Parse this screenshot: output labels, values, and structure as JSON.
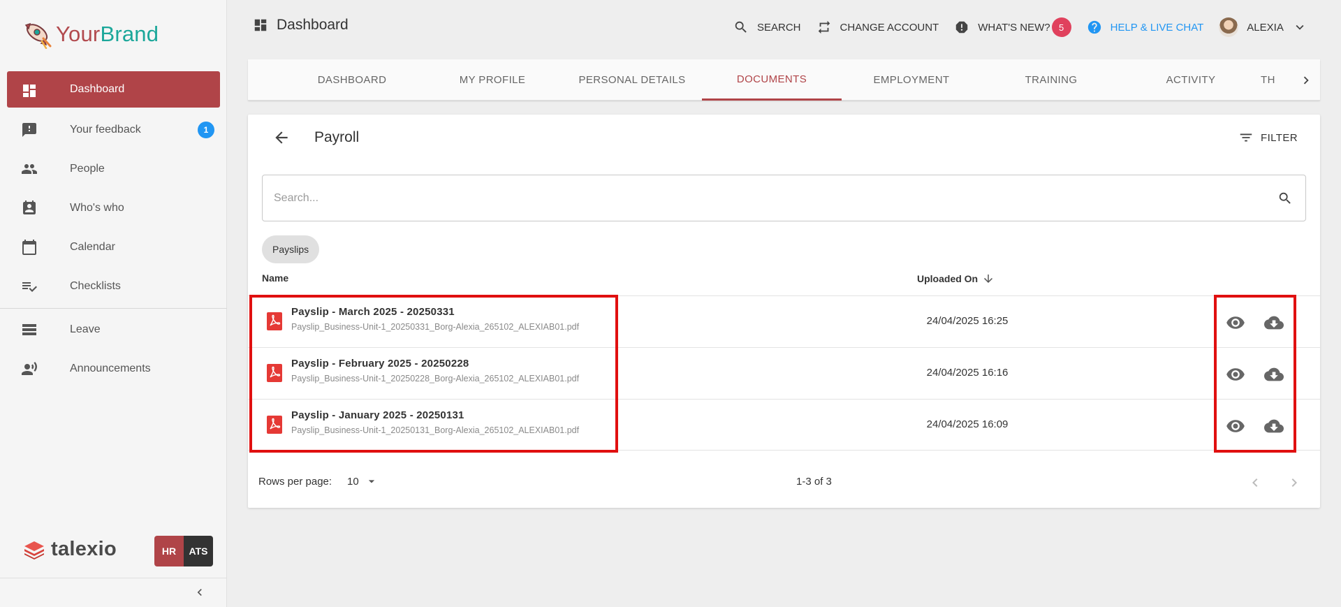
{
  "brand": {
    "part1": "Your",
    "part2": "Brand",
    "color1": "#b24a4e",
    "color2": "#1ba79a"
  },
  "sidebar": {
    "items": [
      {
        "label": "Dashboard",
        "icon": "dashboard-icon",
        "active": true
      },
      {
        "label": "Your feedback",
        "icon": "feedback-icon",
        "badge": "1"
      },
      {
        "label": "People",
        "icon": "people-icon"
      },
      {
        "label": "Who's who",
        "icon": "contact-card-icon"
      },
      {
        "label": "Calendar",
        "icon": "calendar-icon"
      },
      {
        "label": "Checklists",
        "icon": "checklist-icon"
      },
      {
        "label": "Leave",
        "icon": "leave-icon"
      },
      {
        "label": "Announcements",
        "icon": "announcement-icon"
      }
    ],
    "footer": {
      "product": "talexio",
      "hr": "HR",
      "ats": "ATS"
    }
  },
  "header": {
    "title": "Dashboard",
    "search": "SEARCH",
    "change_account": "CHANGE ACCOUNT",
    "whats_new": "WHAT'S NEW?",
    "whats_new_count": "5",
    "help": "HELP & LIVE CHAT",
    "user": "ALEXIA"
  },
  "tabs": [
    "DASHBOARD",
    "MY PROFILE",
    "PERSONAL DETAILS",
    "DOCUMENTS",
    "EMPLOYMENT",
    "TRAINING",
    "ACTIVITY",
    "TH"
  ],
  "active_tab": "DOCUMENTS",
  "main": {
    "title": "Payroll",
    "filter": "FILTER",
    "search_placeholder": "Search...",
    "chip": "Payslips",
    "columns": {
      "name": "Name",
      "uploaded": "Uploaded On"
    },
    "rows": [
      {
        "title": "Payslip - March 2025 - 20250331",
        "file": "Payslip_Business-Unit-1_20250331_Borg-Alexia_265102_ALEXIAB01.pdf",
        "uploaded": "24/04/2025 16:25"
      },
      {
        "title": "Payslip - February 2025 - 20250228",
        "file": "Payslip_Business-Unit-1_20250228_Borg-Alexia_265102_ALEXIAB01.pdf",
        "uploaded": "24/04/2025 16:16"
      },
      {
        "title": "Payslip - January 2025 - 20250131",
        "file": "Payslip_Business-Unit-1_20250131_Borg-Alexia_265102_ALEXIAB01.pdf",
        "uploaded": "24/04/2025 16:09"
      }
    ],
    "pagination": {
      "rows_per_page_label": "Rows per page:",
      "rows_per_page": "10",
      "range": "1-3 of 3"
    }
  },
  "colors": {
    "accent": "#b04448",
    "link": "#2196f3",
    "highlight": "#e01010",
    "badge": "#e0415d"
  }
}
